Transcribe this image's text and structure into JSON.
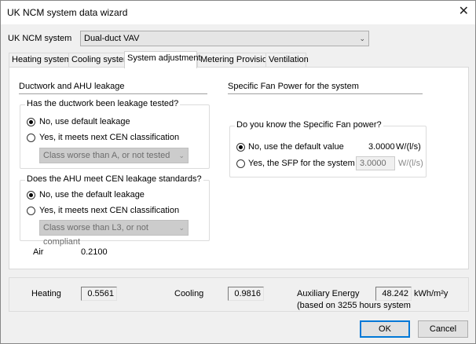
{
  "window": {
    "title": "UK NCM system data wizard",
    "close_glyph": "✕"
  },
  "system": {
    "label": "UK NCM system",
    "selected": "Dual-duct VAV"
  },
  "tabs": [
    {
      "label": "Heating system"
    },
    {
      "label": "Cooling system"
    },
    {
      "label": "System adjustment"
    },
    {
      "label": "Metering Provision"
    },
    {
      "label": "Ventilation"
    }
  ],
  "ductwork": {
    "heading": "Ductwork and AHU leakage",
    "q1": {
      "title": "Has the ductwork been leakage tested?",
      "opt1": "No, use  default leakage",
      "opt2": "Yes, it meets next CEN classification",
      "combo": "Class worse than A, or not tested"
    },
    "q2": {
      "title": "Does the AHU meet CEN leakage standards?",
      "opt1": "No, use the default leakage",
      "opt2": "Yes, it meets next CEN classification",
      "combo": "Class worse than L3, or not compliant"
    },
    "air_label": "Air",
    "air_value": "0.2100"
  },
  "sfp": {
    "heading": "Specific Fan Power for the system",
    "question": "Do you know the Specific Fan power?",
    "opt1": "No, use the default value",
    "opt1_value": "3.0000",
    "unit": "W/(l/s)",
    "opt2": "Yes, the SFP for the system is",
    "opt2_value": "3.0000"
  },
  "summary": {
    "heating_label": "Heating",
    "heating_value": "0.5561",
    "cooling_label": "Cooling",
    "cooling_value": "0.9816",
    "aux_label": "Auxiliary Energy",
    "aux_value": "48.242",
    "aux_unit": "kWh/m²y",
    "aux_note": "(based on 3255 hours system"
  },
  "buttons": {
    "ok": "OK",
    "cancel": "Cancel"
  }
}
